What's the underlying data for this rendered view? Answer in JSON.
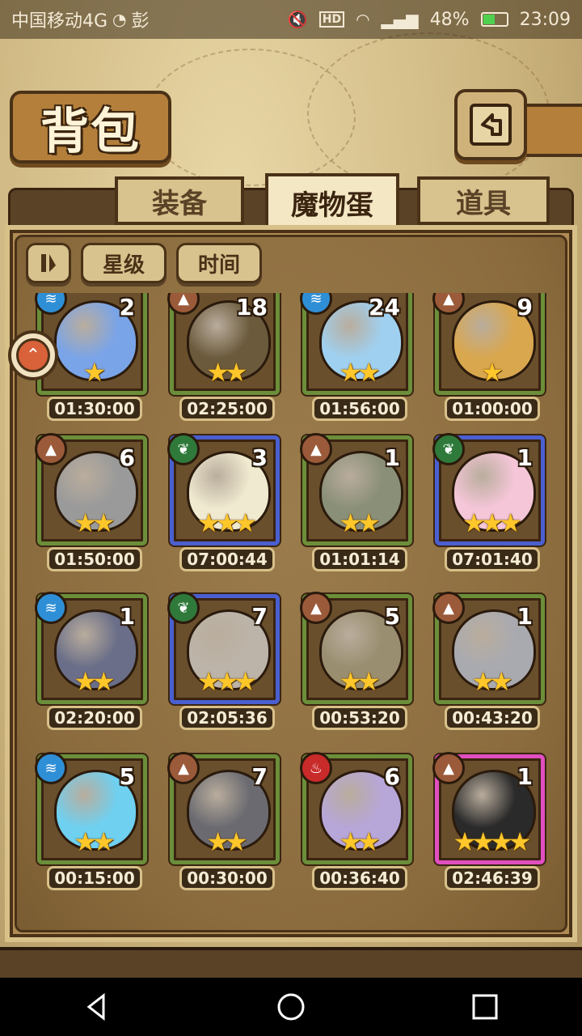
{
  "status_bar": {
    "carrier": "中国移动4G",
    "extra": "彭",
    "battery_percent": "48%",
    "battery_level": 0.48,
    "time": "23:09"
  },
  "header": {
    "title": "背包",
    "back_icon": "back-arrow-icon"
  },
  "tabs": [
    {
      "label": "装备",
      "active": false
    },
    {
      "label": "魔物蛋",
      "active": true
    },
    {
      "label": "道具",
      "active": false
    }
  ],
  "sort_buttons": {
    "toggle_icon": "pause-sort-icon",
    "star": "星级",
    "time": "时间"
  },
  "elements": {
    "earth": {
      "icon": "mountain-icon",
      "color": "#9b5a3a"
    },
    "nature": {
      "icon": "leaf-icon",
      "color": "#2f7a3a"
    },
    "water": {
      "icon": "wave-icon",
      "color": "#2f8fd6"
    },
    "fire": {
      "icon": "flame-icon",
      "color": "#c92a2a"
    }
  },
  "eggs": [
    {
      "count": "2",
      "stars": "★",
      "timer": "01:30:00",
      "element": "water",
      "rarity": 1,
      "color": "#7aa4e8"
    },
    {
      "count": "18",
      "stars": "★★",
      "timer": "02:25:00",
      "element": "earth",
      "rarity": 2,
      "color": "#6b5a3c"
    },
    {
      "count": "24",
      "stars": "★★",
      "timer": "01:56:00",
      "element": "water",
      "rarity": 2,
      "color": "#9fd0f0"
    },
    {
      "count": "9",
      "stars": "★",
      "timer": "01:00:00",
      "element": "earth",
      "rarity": 1,
      "color": "#d9a74e"
    },
    {
      "count": "6",
      "stars": "★★",
      "timer": "01:50:00",
      "element": "earth",
      "rarity": 2,
      "color": "#9a9a9a"
    },
    {
      "count": "3",
      "stars": "★★★",
      "timer": "07:00:44",
      "element": "nature",
      "rarity": 3,
      "color": "#f0ead0"
    },
    {
      "count": "1",
      "stars": "★★",
      "timer": "01:01:14",
      "element": "earth",
      "rarity": 2,
      "color": "#8a8f78"
    },
    {
      "count": "1",
      "stars": "★★★",
      "timer": "07:01:40",
      "element": "nature",
      "rarity": 3,
      "color": "#f5c6d8"
    },
    {
      "count": "1",
      "stars": "★★",
      "timer": "02:20:00",
      "element": "water",
      "rarity": 2,
      "color": "#6a6e88"
    },
    {
      "count": "7",
      "stars": "★★★",
      "timer": "02:05:36",
      "element": "nature",
      "rarity": 3,
      "color": "#bcb4a8"
    },
    {
      "count": "5",
      "stars": "★★",
      "timer": "00:53:20",
      "element": "earth",
      "rarity": 2,
      "color": "#9a8e70"
    },
    {
      "count": "1",
      "stars": "★★",
      "timer": "00:43:20",
      "element": "earth",
      "rarity": 2,
      "color": "#a9aab0"
    },
    {
      "count": "5",
      "stars": "★★",
      "timer": "00:15:00",
      "element": "water",
      "rarity": 2,
      "color": "#6fd0f0"
    },
    {
      "count": "7",
      "stars": "★★",
      "timer": "00:30:00",
      "element": "earth",
      "rarity": 2,
      "color": "#6a6a70"
    },
    {
      "count": "6",
      "stars": "★★",
      "timer": "00:36:40",
      "element": "fire",
      "rarity": 2,
      "color": "#b7a6d8"
    },
    {
      "count": "1",
      "stars": "★★★★",
      "timer": "02:46:39",
      "element": "earth",
      "rarity": 4,
      "color": "#2a2a2a"
    }
  ],
  "side_badge_icon": "scroll-up-icon",
  "nav": {
    "back": "nav-back-icon",
    "home": "nav-home-icon",
    "recent": "nav-recent-icon"
  }
}
